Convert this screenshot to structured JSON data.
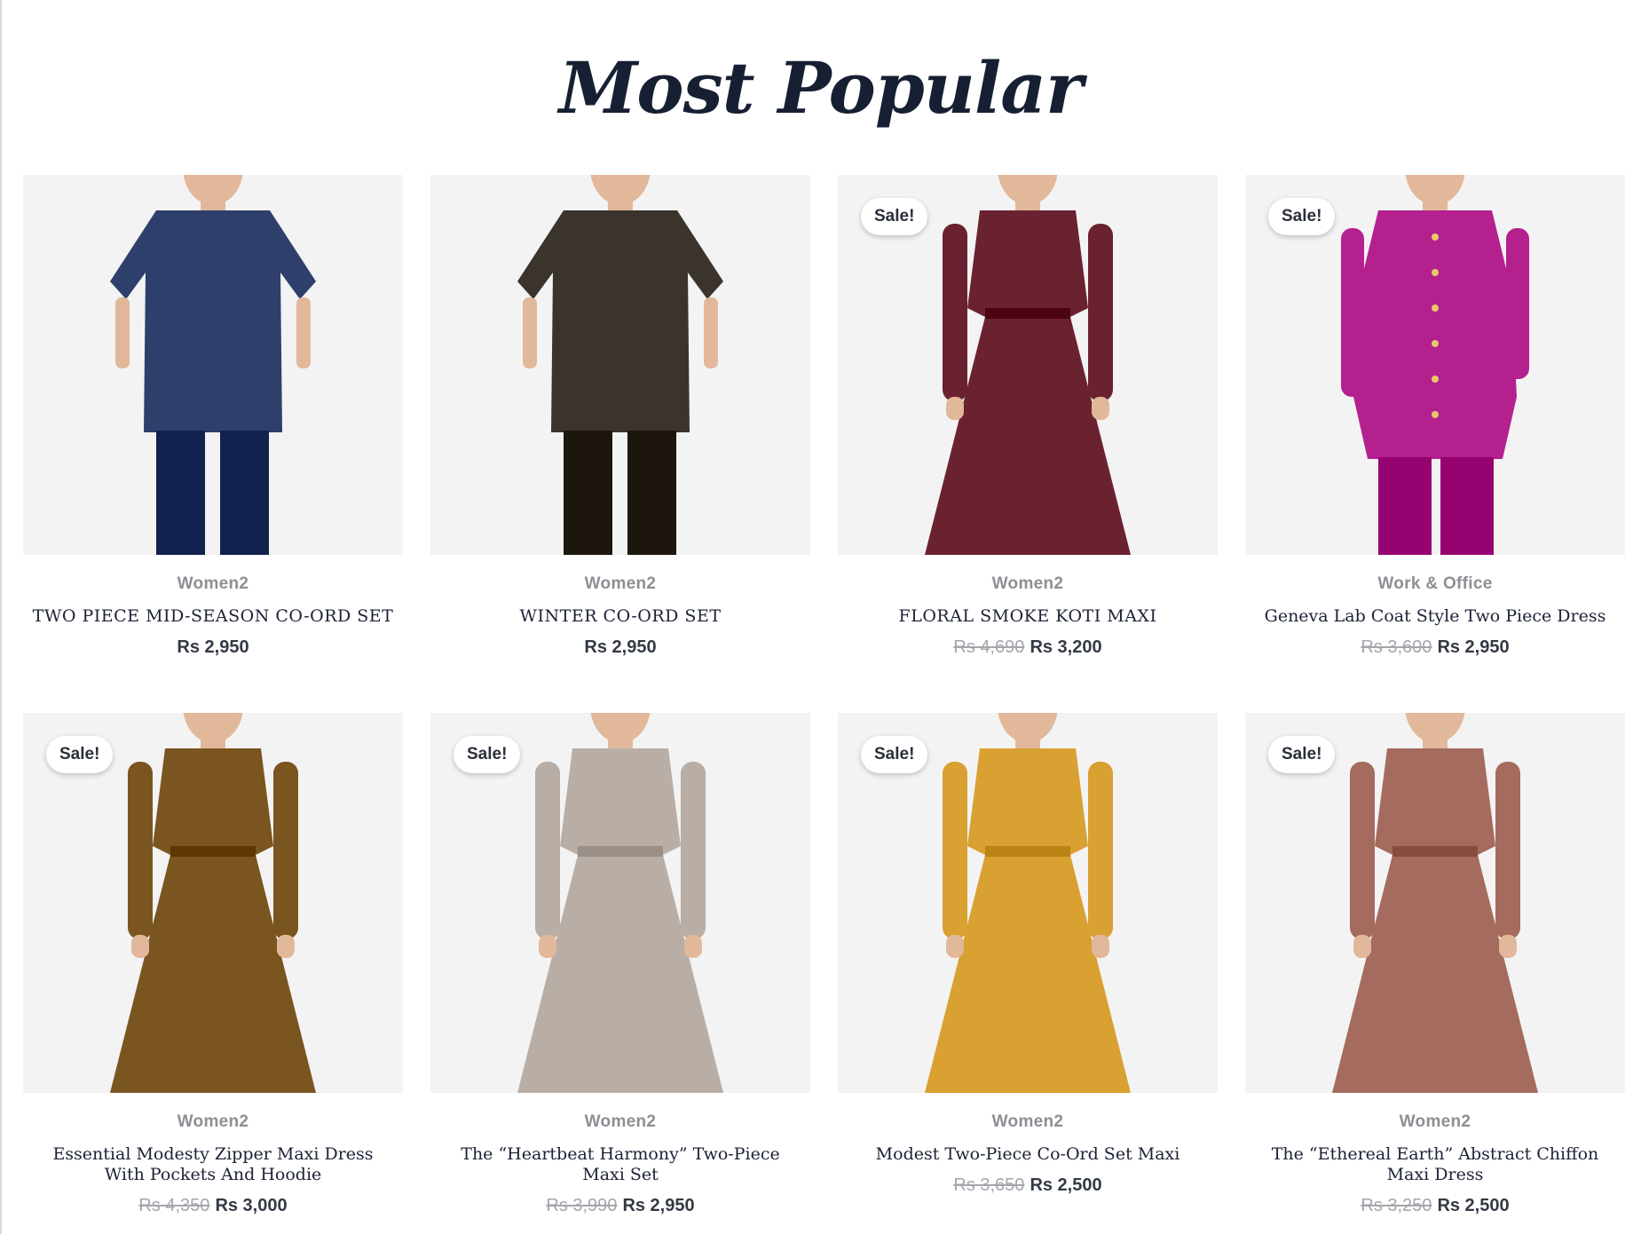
{
  "section": {
    "title": "Most Popular"
  },
  "sale_label": "Sale!",
  "products": [
    {
      "category": "Women2",
      "name": "TWO PIECE MID-SEASON CO-ORD SET",
      "old_price": "",
      "price": "Rs 2,950",
      "on_sale": false,
      "color": "#2e3f6b",
      "style": "coord"
    },
    {
      "category": "Women2",
      "name": "WINTER CO-ORD SET",
      "old_price": "",
      "price": "Rs 2,950",
      "on_sale": false,
      "color": "#3a342c",
      "style": "coord"
    },
    {
      "category": "Women2",
      "name": "FLORAL SMOKE KOTI MAXI",
      "old_price": "Rs 4,690",
      "price": "Rs 3,200",
      "on_sale": true,
      "color": "#6b2230",
      "style": "maxi"
    },
    {
      "category": "Work & Office",
      "name": "Geneva Lab Coat Style Two Piece Dress",
      "old_price": "Rs 3,600",
      "price": "Rs 2,950",
      "on_sale": true,
      "color": "#b5208f",
      "style": "coat"
    },
    {
      "category": "Women2",
      "name": "Essential Modesty Zipper Maxi Dress With Pockets And Hoodie",
      "old_price": "Rs 4,350",
      "price": "Rs 3,000",
      "on_sale": true,
      "color": "#7a5520",
      "style": "maxi"
    },
    {
      "category": "Women2",
      "name": "The “Heartbeat Harmony” Two-Piece Maxi Set",
      "old_price": "Rs 3,990",
      "price": "Rs 2,950",
      "on_sale": true,
      "color": "#b9aea5",
      "style": "maxi"
    },
    {
      "category": "Women2",
      "name": "Modest Two-Piece Co-Ord Set Maxi",
      "old_price": "Rs 3,650",
      "price": "Rs 2,500",
      "on_sale": true,
      "color": "#d9a032",
      "style": "maxi"
    },
    {
      "category": "Women2",
      "name": "The “Ethereal Earth” Abstract Chiffon Maxi Dress",
      "old_price": "Rs 3,250",
      "price": "Rs 2,500",
      "on_sale": true,
      "color": "#a46b5e",
      "style": "maxi"
    }
  ]
}
